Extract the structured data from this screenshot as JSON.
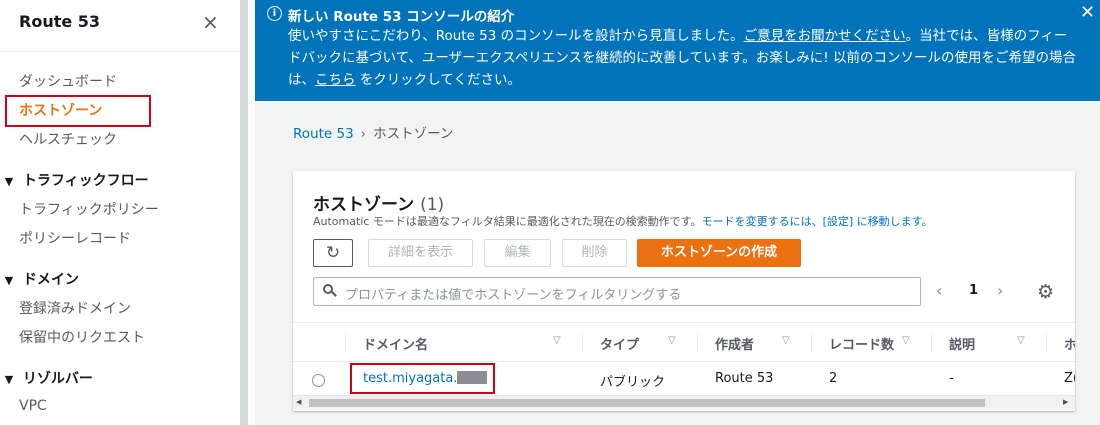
{
  "sidebar": {
    "title": "Route 53",
    "close_icon": "×",
    "items": [
      {
        "label": "ダッシュボード"
      },
      {
        "label": "ホストゾーン"
      },
      {
        "label": "ヘルスチェック"
      }
    ],
    "groups": [
      {
        "label": "トラフィックフロー",
        "items": [
          "トラフィックポリシー",
          "ポリシーレコード"
        ]
      },
      {
        "label": "ドメイン",
        "items": [
          "登録済みドメイン",
          "保留中のリクエスト"
        ]
      },
      {
        "label": "リゾルバー",
        "items": [
          "VPC"
        ]
      }
    ],
    "caret": "▼"
  },
  "flash": {
    "icon": "i",
    "title": "新しい Route 53 コンソールの紹介",
    "body_1": "使いやすさにこだわり、Route 53 のコンソールを設計から見直しました。",
    "feedback_link": "ご意見をお聞かせください",
    "body_2": "。当社では、皆様のフィードバックに基づいて、ユーザーエクスペリエンスを継続的に改善しています。お楽しみに! 以前のコンソールの使用をご希望の場合は、",
    "here_link": "こちら",
    "body_3": " をクリックしてください。",
    "close_icon": "✕"
  },
  "breadcrumb": {
    "root": "Route 53",
    "separator": "›",
    "current": "ホストゾーン"
  },
  "panel": {
    "title": "ホストゾーン",
    "count": "(1)",
    "desc_1": "Automatic モードは最適なフィルタ結果に最適化された現在の検索動作です。",
    "desc_link": "モードを変更するには、[設定] に移動します。",
    "buttons": {
      "refresh": "↻",
      "details": "詳細を表示",
      "edit": "編集",
      "delete": "削除",
      "create": "ホストゾーンの作成"
    },
    "filter_placeholder": "プロパティまたは値でホストゾーンをフィルタリングする",
    "pager": {
      "prev": "‹",
      "page": "1",
      "next": "›"
    },
    "settings_icon": "⚙"
  },
  "table": {
    "columns": [
      "ドメイン名",
      "タイプ",
      "作成者",
      "レコード数",
      "説明",
      "ホ"
    ],
    "sort_icon": "▽",
    "rows": [
      {
        "domain": "test.miyagata.",
        "type": "パブリック",
        "creator": "Route 53",
        "records": "2",
        "description": "-",
        "extra": "Z("
      }
    ]
  },
  "scrollbar": {
    "left": "◀",
    "right": "▶"
  }
}
